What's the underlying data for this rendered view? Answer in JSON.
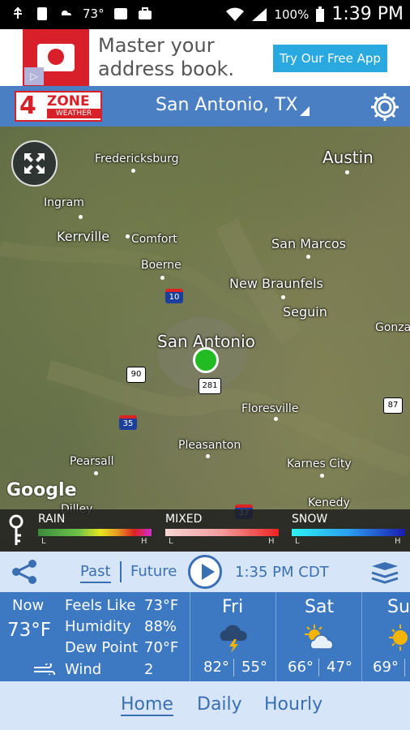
{
  "status_bar": {
    "temp": "73°",
    "battery": "100%",
    "time": "1:39 PM"
  },
  "ad": {
    "text_line1": "Master your",
    "text_line2": "address book.",
    "cta": "Try Our Free App"
  },
  "header": {
    "logo_number": "4",
    "logo_zone": "ZONE",
    "logo_weather": "WEATHER",
    "location": "San Antonio, TX"
  },
  "map": {
    "cities": {
      "fredericksburg": "Fredericksburg",
      "austin": "Austin",
      "ingram": "Ingram",
      "kerrville": "Kerrville",
      "comfort": "Comfort",
      "san_marcos": "San Marcos",
      "boerne": "Boerne",
      "new_braunfels": "New Braunfels",
      "seguin": "Seguin",
      "gonzales": "Gonza",
      "san_antonio": "San Antonio",
      "floresville": "Floresville",
      "pleasanton": "Pleasanton",
      "pearsall": "Pearsall",
      "karnes_city": "Karnes City",
      "kenedy": "Kenedy",
      "dilley": "Dilley"
    },
    "roads": {
      "i10": "10",
      "us90": "90",
      "us281": "281",
      "i35": "35",
      "us87": "87",
      "i37": "37"
    },
    "attribution": "Google"
  },
  "legend": {
    "rain": {
      "label": "RAIN",
      "low": "L",
      "high": "H"
    },
    "mixed": {
      "label": "MIXED",
      "low": "L",
      "high": "H"
    },
    "snow": {
      "label": "SNOW",
      "low": "L",
      "high": "H"
    }
  },
  "controls": {
    "past": "Past",
    "future": "Future",
    "time": "1:35 PM CDT"
  },
  "current": {
    "now_label": "Now",
    "now_temp": "73°F",
    "feels_like_label": "Feels Like",
    "feels_like_value": "73°F",
    "humidity_label": "Humidity",
    "humidity_value": "88%",
    "dew_point_label": "Dew Point",
    "dew_point_value": "70°F",
    "wind_label": "Wind",
    "wind_value": "2"
  },
  "forecast": [
    {
      "day": "Fri",
      "icon": "thunderstorm-icon",
      "hi": "82°",
      "lo": "55°"
    },
    {
      "day": "Sat",
      "icon": "partly-sunny-icon",
      "hi": "66°",
      "lo": "47°"
    },
    {
      "day": "Su",
      "icon": "sunny-icon",
      "hi": "69°",
      "lo": ""
    }
  ],
  "bottom_nav": {
    "home": "Home",
    "daily": "Daily",
    "hourly": "Hourly"
  },
  "colors": {
    "app_blue": "#4b7fc3",
    "weather_blue": "#3d78c2",
    "light_panel": "#d6e6f8",
    "accent_text": "#3b6fb3",
    "marker_green": "#22bb22"
  }
}
